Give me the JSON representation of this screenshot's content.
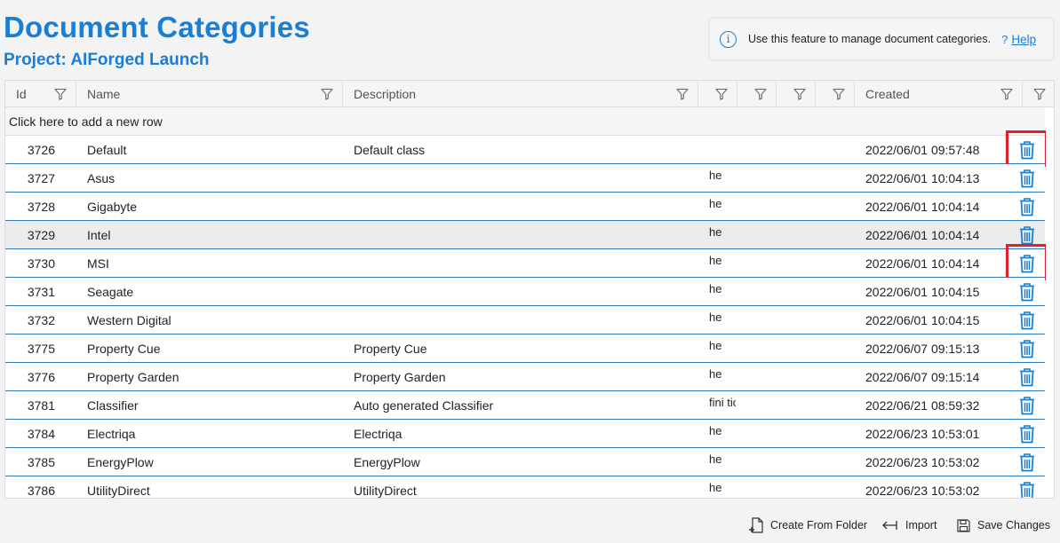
{
  "page": {
    "title": "Document Categories",
    "subtitle": "Project: AIForged Launch"
  },
  "info": {
    "text": "Use this feature to manage document categories.",
    "help_prefix": "?",
    "help_label": "Help"
  },
  "grid": {
    "columns": [
      {
        "label": "Id"
      },
      {
        "label": "Name"
      },
      {
        "label": "Description"
      },
      {
        "label": ""
      },
      {
        "label": ""
      },
      {
        "label": ""
      },
      {
        "label": ""
      },
      {
        "label": "Created"
      },
      {
        "label": ""
      }
    ],
    "add_row_label": "Click here to add a new row",
    "rows": [
      {
        "id": "3726",
        "name": "Default",
        "description": "Default class",
        "frag": "",
        "created": "2022/06/01 09:57:48",
        "highlighted": false,
        "delete_outlined": true
      },
      {
        "id": "3727",
        "name": "Asus",
        "description": "",
        "frag": "he",
        "created": "2022/06/01 10:04:13",
        "highlighted": false,
        "delete_outlined": false
      },
      {
        "id": "3728",
        "name": "Gigabyte",
        "description": "",
        "frag": "he",
        "created": "2022/06/01 10:04:14",
        "highlighted": false,
        "delete_outlined": false
      },
      {
        "id": "3729",
        "name": "Intel",
        "description": "",
        "frag": "he",
        "created": "2022/06/01 10:04:14",
        "highlighted": true,
        "delete_outlined": false
      },
      {
        "id": "3730",
        "name": "MSI",
        "description": "",
        "frag": "he",
        "created": "2022/06/01 10:04:14",
        "highlighted": false,
        "delete_outlined": true
      },
      {
        "id": "3731",
        "name": "Seagate",
        "description": "",
        "frag": "he",
        "created": "2022/06/01 10:04:15",
        "highlighted": false,
        "delete_outlined": false
      },
      {
        "id": "3732",
        "name": "Western Digital",
        "description": "",
        "frag": "he",
        "created": "2022/06/01 10:04:15",
        "highlighted": false,
        "delete_outlined": false
      },
      {
        "id": "3775",
        "name": "Property Cue",
        "description": "Property Cue",
        "frag": "he",
        "created": "2022/06/07 09:15:13",
        "highlighted": false,
        "delete_outlined": false
      },
      {
        "id": "3776",
        "name": "Property Garden",
        "description": "Property Garden",
        "frag": "he",
        "created": "2022/06/07 09:15:14",
        "highlighted": false,
        "delete_outlined": false
      },
      {
        "id": "3781",
        "name": "Classifier",
        "description": "Auto generated Classifier",
        "frag": "fini tio",
        "created": "2022/06/21 08:59:32",
        "highlighted": false,
        "delete_outlined": false
      },
      {
        "id": "3784",
        "name": "Electriqa",
        "description": "Electriqa",
        "frag": "he",
        "created": "2022/06/23 10:53:01",
        "highlighted": false,
        "delete_outlined": false
      },
      {
        "id": "3785",
        "name": "EnergyPlow",
        "description": "EnergyPlow",
        "frag": "he",
        "created": "2022/06/23 10:53:02",
        "highlighted": false,
        "delete_outlined": false
      },
      {
        "id": "3786",
        "name": "UtilityDirect",
        "description": "UtilityDirect",
        "frag": "he",
        "created": "2022/06/23 10:53:02",
        "highlighted": false,
        "delete_outlined": false
      }
    ]
  },
  "footer": {
    "create_from_folder": "Create From Folder",
    "import": "Import",
    "save_changes": "Save Changes"
  },
  "colors": {
    "accent": "#1a7fd4",
    "row_border": "#2d7cc0",
    "highlight_box": "#e0202a"
  }
}
